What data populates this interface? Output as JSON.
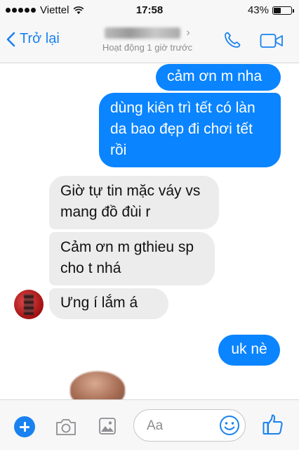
{
  "status_bar": {
    "carrier": "Viettel",
    "time": "17:58",
    "battery_percent": "43%",
    "battery_level": 0.43
  },
  "nav": {
    "back_label": "Trở lại",
    "subtitle": "Hoạt động 1 giờ trước"
  },
  "messages": [
    {
      "sender": "me",
      "text": "cảm ơn m nha"
    },
    {
      "sender": "me",
      "text": "dùng kiên trì tết có làn da bao đẹp đi chơi tết rồi"
    },
    {
      "sender": "them",
      "text": "Giờ tự tin mặc váy vs mang đồ đùi r"
    },
    {
      "sender": "them",
      "text": "Cảm ơn m gthieu sp cho t nhá"
    },
    {
      "sender": "them",
      "text": "Ưng í lắm á"
    },
    {
      "sender": "me",
      "text": "uk nè"
    }
  ],
  "composer": {
    "placeholder": "Aa"
  },
  "colors": {
    "accent": "#1982f0",
    "outgoing_bubble": "#0a84ff",
    "incoming_bubble": "#ececec"
  },
  "icons": [
    "wifi-icon",
    "back-chevron-icon",
    "phone-icon",
    "video-camera-icon",
    "plus-icon",
    "camera-icon",
    "photo-icon",
    "smile-icon",
    "thumbs-up-icon"
  ]
}
